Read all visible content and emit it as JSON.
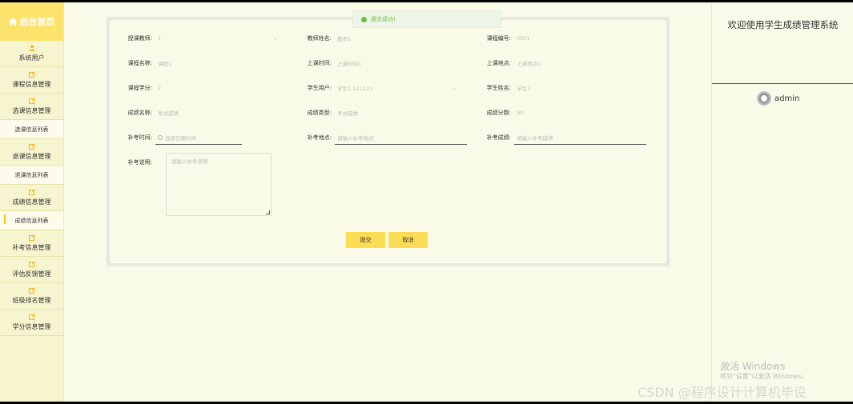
{
  "sidebar": {
    "home_label": "后台首页",
    "items": [
      {
        "label": "系统用户"
      },
      {
        "label": "课程信息管理"
      },
      {
        "label": "选课信息管理"
      },
      {
        "label": "选课信息列表"
      },
      {
        "label": "退课信息管理"
      },
      {
        "label": "退课信息列表"
      },
      {
        "label": "成绩信息管理"
      },
      {
        "label": "成绩信息列表"
      },
      {
        "label": "补考信息管理"
      },
      {
        "label": "评估反馈管理"
      },
      {
        "label": "班级排名管理"
      },
      {
        "label": "学分信息管理"
      }
    ]
  },
  "toast": {
    "message": "提交成功!"
  },
  "form": {
    "teacher": {
      "label": "授课教师:",
      "value": "1"
    },
    "teacher_name": {
      "label": "教师姓名:",
      "value": "教师1"
    },
    "course_no": {
      "label": "课程编号:",
      "value": "0001"
    },
    "course_name": {
      "label": "课程名称:",
      "value": "课程1"
    },
    "class_time": {
      "label": "上课时间:",
      "value": "上课时间1"
    },
    "class_place": {
      "label": "上课地点:",
      "value": "上课地点1"
    },
    "course_credit": {
      "label": "课程学分:",
      "value": "2"
    },
    "student_user": {
      "label": "学生用户:",
      "value": "学生1-111111"
    },
    "student_name": {
      "label": "学生姓名:",
      "value": "学生1"
    },
    "score_name": {
      "label": "成绩名称:",
      "value": "考试成绩"
    },
    "score_type": {
      "label": "成绩类型:",
      "value": "考试成绩"
    },
    "score_value": {
      "label": "成绩分数:",
      "value": "90"
    },
    "makeup_time": {
      "label": "补考时间:",
      "placeholder": "选择日期时间"
    },
    "makeup_place": {
      "label": "补考地点:",
      "placeholder": "请输入补考地点"
    },
    "makeup_score": {
      "label": "补考成绩:",
      "placeholder": "请输入补考成绩"
    },
    "makeup_note": {
      "label": "补考说明:",
      "placeholder": "请输入补考说明"
    },
    "submit_label": "提交",
    "cancel_label": "取消"
  },
  "header": {
    "welcome": "欢迎使用学生成绩管理系统",
    "username": "admin"
  },
  "watermarks": {
    "activate": "激活 Windows",
    "activate_hint": "转到\"设置\"以激活 Windows。",
    "csdn": "CSDN @程序设计计算机毕设"
  },
  "colors": {
    "accent": "#fbdc55",
    "sidebar_bg": "#f7f5cf",
    "success": "#67c23a"
  }
}
